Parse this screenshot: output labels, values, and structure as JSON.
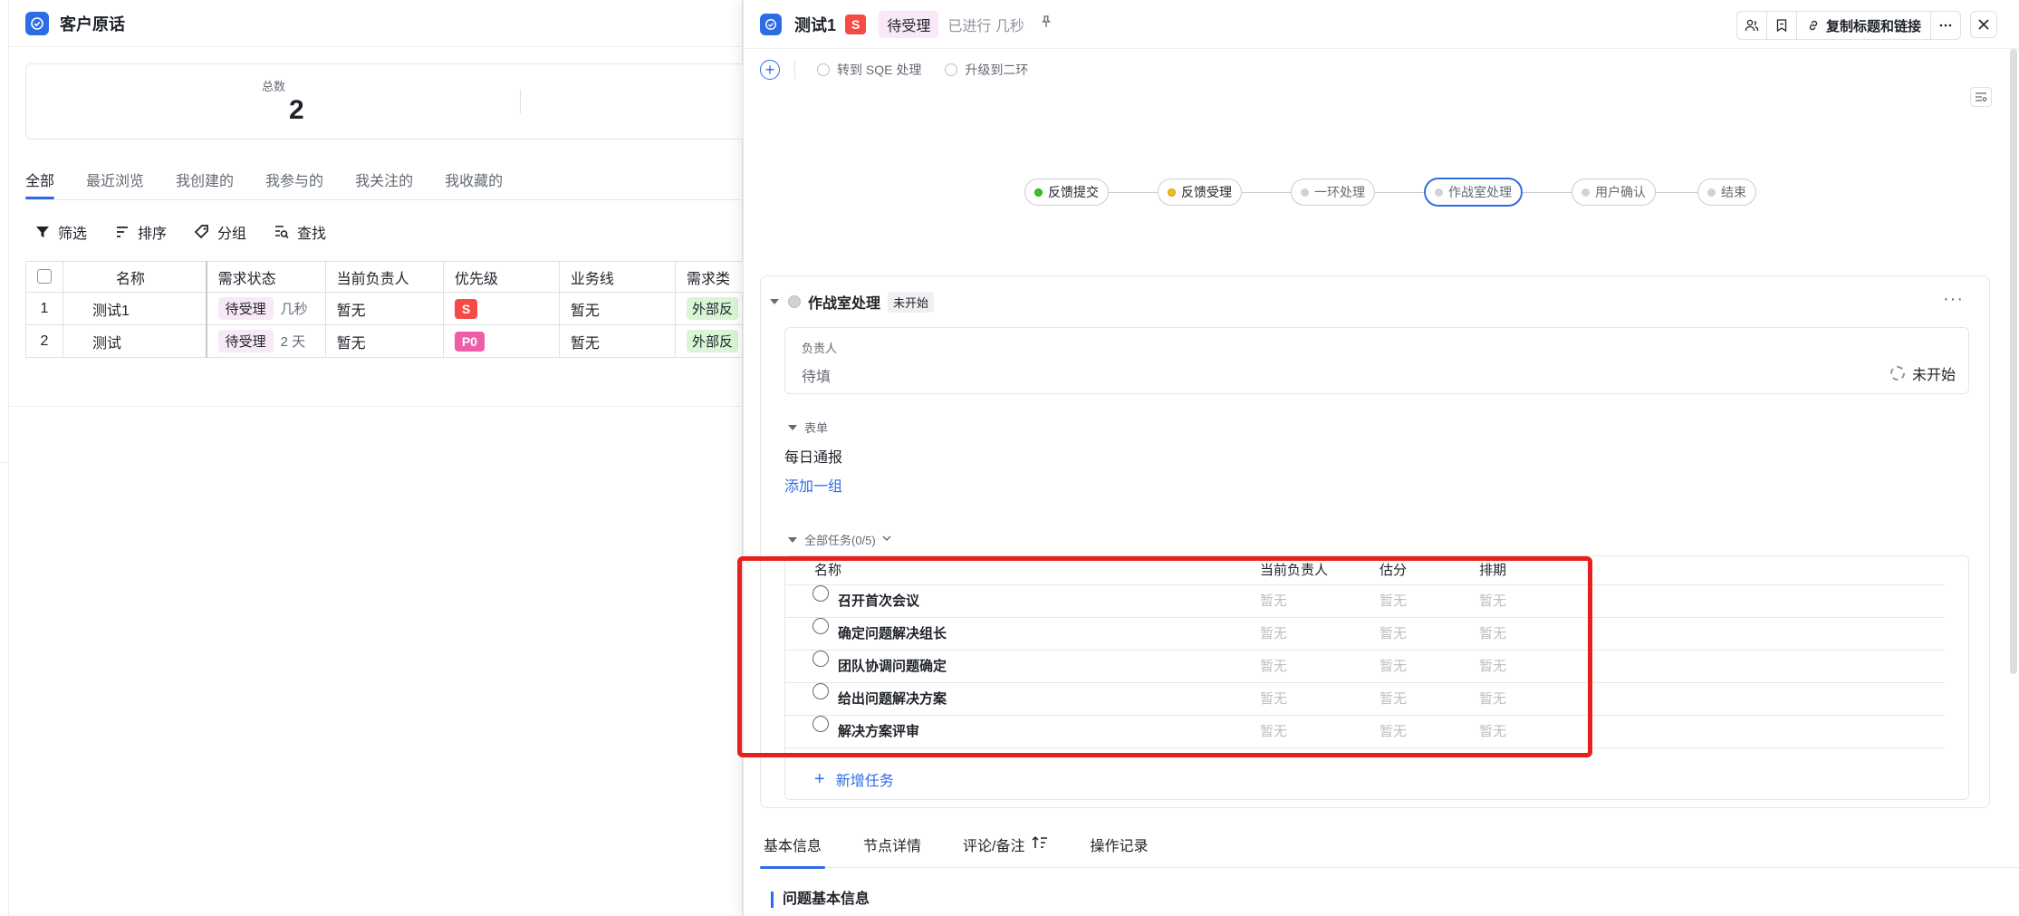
{
  "list_page": {
    "title": "客户原话",
    "stats": {
      "total_label": "总数",
      "total_value": "2"
    },
    "view_tabs": [
      "全部",
      "最近浏览",
      "我创建的",
      "我参与的",
      "我关注的",
      "我收藏的"
    ],
    "toolbar": {
      "filter": "筛选",
      "sort": "排序",
      "group": "分组",
      "find": "查找"
    },
    "columns": [
      "名称",
      "需求状态",
      "当前负责人",
      "优先级",
      "业务线",
      "需求类"
    ],
    "rows": [
      {
        "idx": "1",
        "name": "测试1",
        "status": "待受理",
        "since": "几秒",
        "owner": "暂无",
        "priority": "S",
        "biz": "暂无",
        "type": "外部反"
      },
      {
        "idx": "2",
        "name": "测试",
        "status": "待受理",
        "since": "2 天",
        "owner": "暂无",
        "priority": "P0",
        "biz": "暂无",
        "type": "外部反"
      }
    ]
  },
  "detail": {
    "title": "测试1",
    "priority": "S",
    "status": "待受理",
    "since": "已进行 几秒",
    "copy_label": "复制标题和链接",
    "sub_actions": {
      "to_sqe": "转到 SQE 处理",
      "upgrade": "升级到二环"
    },
    "flow": [
      {
        "label": "反馈提交",
        "state": "done"
      },
      {
        "label": "反馈受理",
        "state": "current"
      },
      {
        "label": "一环处理",
        "state": "pending"
      },
      {
        "label": "作战室处理",
        "state": "selected"
      },
      {
        "label": "用户确认",
        "state": "pending"
      },
      {
        "label": "结束",
        "state": "pending"
      }
    ],
    "node": {
      "title": "作战室处理",
      "badge": "未开始",
      "owner_label": "负责人",
      "owner_value": "待填",
      "owner_status": "未开始",
      "form_section": "表单",
      "form_item": "每日通报",
      "add_group": "添加一组",
      "tasks_section": "全部任务(0/5)",
      "task_columns": {
        "name": "名称",
        "owner": "当前负责人",
        "estimate": "估分",
        "schedule": "排期"
      },
      "tasks": [
        {
          "name": "召开首次会议",
          "owner": "暂无",
          "estimate": "暂无",
          "schedule": "暂无"
        },
        {
          "name": "确定问题解决组长",
          "owner": "暂无",
          "estimate": "暂无",
          "schedule": "暂无"
        },
        {
          "name": "团队协调问题确定",
          "owner": "暂无",
          "estimate": "暂无",
          "schedule": "暂无"
        },
        {
          "name": "给出问题解决方案",
          "owner": "暂无",
          "estimate": "暂无",
          "schedule": "暂无"
        },
        {
          "name": "解决方案评审",
          "owner": "暂无",
          "estimate": "暂无",
          "schedule": "暂无"
        }
      ],
      "add_task": "新增任务"
    },
    "bottom_tabs": [
      "基本信息",
      "节点详情",
      "评论/备注",
      "操作记录"
    ],
    "basic_info_title": "问题基本信息"
  },
  "colors": {
    "accent": "#2e6ce6",
    "danger": "#f54a45",
    "highlight": "#e8201c"
  }
}
